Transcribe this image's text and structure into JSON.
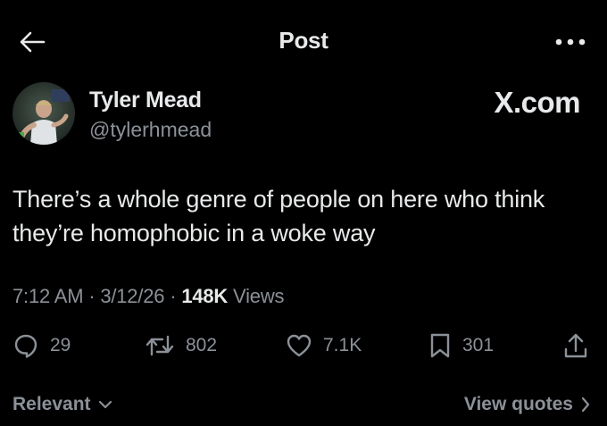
{
  "header": {
    "title": "Post",
    "back_icon": "arrow-left-icon",
    "more_icon": "more-dots-icon"
  },
  "author": {
    "name": "Tyler Mead",
    "handle": "@tylerhmead"
  },
  "watermark": "X.com",
  "tweet": {
    "text": "There’s a whole genre of people on here who think they’re homophobic in a woke way"
  },
  "meta": {
    "time": "7:12 AM",
    "separator": "·",
    "date": "3/12/26",
    "views_count": "148K",
    "views_label": "Views"
  },
  "actions": {
    "replies": "29",
    "reposts": "802",
    "likes": "7.1K",
    "bookmarks": "301"
  },
  "footer": {
    "sort_label": "Relevant",
    "view_quotes_label": "View quotes"
  },
  "colors": {
    "background": "#000000",
    "text_primary": "#e7e9ea",
    "text_secondary": "#8b9197"
  }
}
